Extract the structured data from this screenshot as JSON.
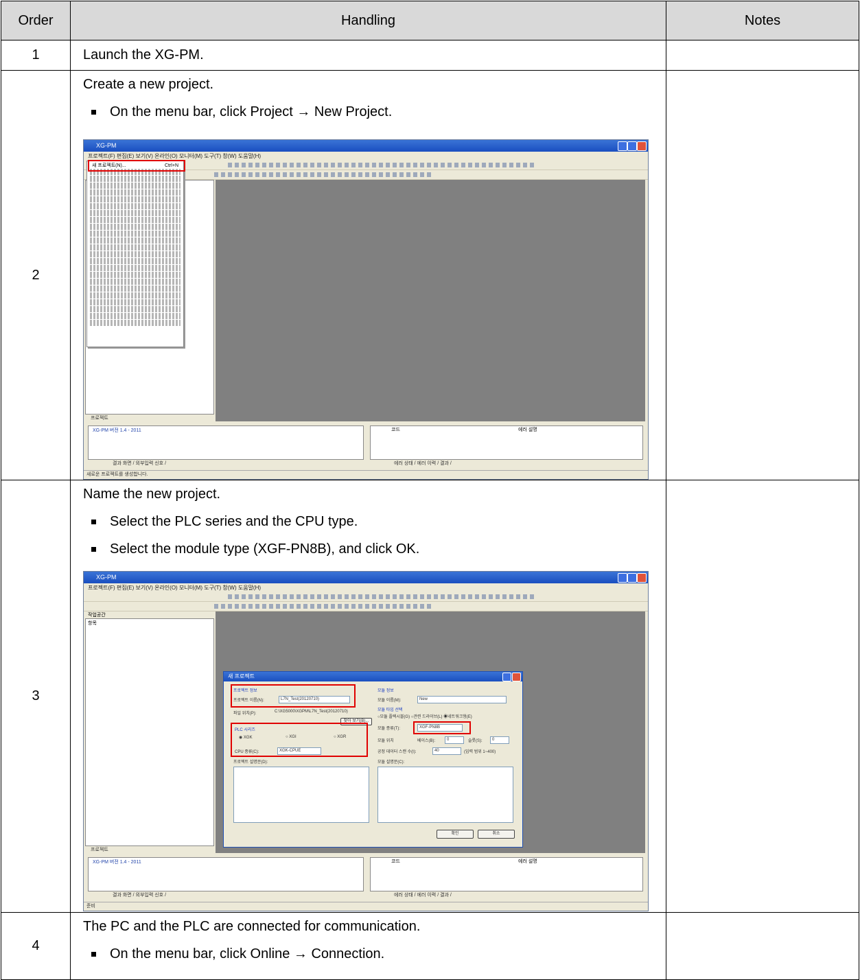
{
  "table": {
    "headers": {
      "order": "Order",
      "handling": "Handling",
      "notes": "Notes"
    },
    "rows": [
      {
        "order": "1",
        "text": "Launch the XG-PM.",
        "notes": ""
      },
      {
        "order": "2",
        "text": "Create a new project.",
        "bullets": [
          {
            "before": "On the menu bar, click Project ",
            "arrow": "→",
            "after": " New Project."
          }
        ],
        "notes": ""
      },
      {
        "order": "3",
        "text": "Name the new project.",
        "bullets": [
          "Select the PLC series and the CPU type.",
          "Select the module type (XGF-PN8B), and click OK."
        ],
        "notes": ""
      },
      {
        "order": "4",
        "text": "The PC and the PLC are connected for communication.",
        "bullets": [
          {
            "before": "On the menu bar, click Online ",
            "arrow": "→",
            "after": " Connection."
          }
        ],
        "notes": ""
      }
    ]
  },
  "screenshots": {
    "shot1": {
      "title": "XG-PM",
      "menubar": "프로젝트(F)  편집(E)  보기(V)  온라인(O)  모니터(M)  도구(T)  창(W)  도움말(H)",
      "highlighted_menu_item": "새 프로젝트(N)...",
      "shortcut": "Ctrl+N",
      "output_text": "XG-PM 버전 1.4 - 2011",
      "tab_label": "프로젝트",
      "status_text": "새로운 프로젝트를 생성합니다.",
      "bottom_tabs_left": "결과 화면 / 외부입력 신호 /",
      "bottom_tabs_right": "에러 상태 / 에러 이력 / 결과 /",
      "column_code": "코드",
      "column_desc": "에러 설명"
    },
    "shot2": {
      "title": "XG-PM",
      "menubar": "프로젝트(F)  편집(E)  보기(V)  온라인(O)  모니터(M)  도구(T)  창(W)  도움말(H)",
      "workspace_label": "작업공간",
      "tree_label": "항목",
      "dialog_title": "새 프로젝트",
      "project_info_label": "프로젝트 정보",
      "project_name_label": "프로젝트 이름(N):",
      "project_name_value": "L7N_Test(20120710)",
      "file_location_label": "파일 위치(P):",
      "file_location_value": "C:\\XG5000\\XGPM\\L7N_Test(20120710)",
      "browse_button": "찾아 보기(B)...",
      "plc_series_label": "PLC 시리즈",
      "plc_options": [
        "XGK",
        "XGI",
        "XGR"
      ],
      "cpu_type_label": "CPU 종류(C):",
      "cpu_type_value": "XGK-CPUE",
      "project_desc_label": "프로젝트 설명문(D):",
      "module_info_label": "모듈 정보",
      "module_name_label": "모듈 이름(M):",
      "module_name_value": "New",
      "module_type_select_label": "모듈 타입 선택",
      "module_type_options": "○모듈 플렉시블(G) ○관련 드라이브(L) ◉네트워크형(E)",
      "module_kind_label": "모듈 종류(T):",
      "module_kind_value": "XGF-PN8B",
      "module_pos_label": "모듈 위치",
      "base_label": "베이스(B):",
      "base_value": "0",
      "slot_label": "슬롯(S):",
      "slot_value": "0",
      "scan_label": "공정 데이터 스캔 수(I):",
      "scan_value": "40",
      "scan_range": "(입력 범위 1~400)",
      "module_desc_label": "모듈 설명문(C):",
      "ok_button": "확인",
      "cancel_button": "취소",
      "output_text": "XG-PM 버전 1.4 - 2011",
      "tab_label": "프로젝트",
      "status_text": "준비",
      "bottom_tabs_left": "결과 화면 / 외부입력 신호 /",
      "bottom_tabs_right": "에러 상태 / 에러 이력 / 결과 /",
      "column_code": "코드",
      "column_desc": "에러 설명"
    }
  }
}
